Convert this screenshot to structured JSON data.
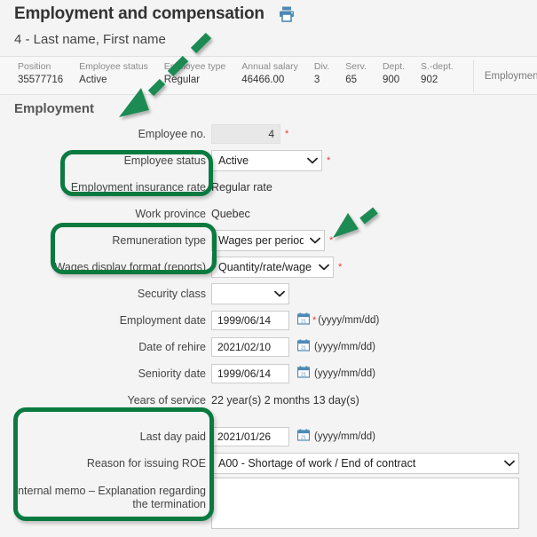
{
  "header": {
    "title": "Employment and compensation",
    "print_icon": "print-icon",
    "subtitle": "4 - Last name, First name"
  },
  "summary": {
    "cells": [
      {
        "label": "Position",
        "value": "35577716"
      },
      {
        "label": "Employee status",
        "value": "Active"
      },
      {
        "label": "Employee type",
        "value": "Regular"
      },
      {
        "label": "Annual salary",
        "value": "46466.00"
      },
      {
        "label": "Div.",
        "value": "3"
      },
      {
        "label": "Serv.",
        "value": "65"
      },
      {
        "label": "Dept.",
        "value": "900"
      },
      {
        "label": "S.-dept.",
        "value": "902"
      }
    ],
    "tab": "Employment"
  },
  "section": {
    "title": "Employment"
  },
  "fields": {
    "employee_no": {
      "label": "Employee no.",
      "value": "4",
      "required": "*"
    },
    "employee_status": {
      "label": "Employee status",
      "value": "Active",
      "required": "*"
    },
    "ei_rate": {
      "label": "Employment insurance rate",
      "value": "Regular rate"
    },
    "work_province": {
      "label": "Work province",
      "value": "Quebec"
    },
    "remuneration_type": {
      "label": "Remuneration type",
      "value": "Wages per period",
      "required": "*"
    },
    "wages_display_format": {
      "label": "Wages display format (reports)",
      "value": "Quantity/rate/wage",
      "required": "*"
    },
    "security_class": {
      "label": "Security class",
      "value": ""
    },
    "employment_date": {
      "label": "Employment date",
      "value": "1999/06/14",
      "required": "*",
      "hint": "(yyyy/mm/dd)",
      "icon": "calendar-icon"
    },
    "date_of_rehire": {
      "label": "Date of rehire",
      "value": "2021/02/10",
      "hint": "(yyyy/mm/dd)",
      "icon": "calendar-icon"
    },
    "seniority_date": {
      "label": "Seniority date",
      "value": "1999/06/14",
      "hint": "(yyyy/mm/dd)",
      "icon": "calendar-icon"
    },
    "years_of_service": {
      "label": "Years of service",
      "value": "22 year(s) 2 months 13 day(s)"
    },
    "last_day_paid": {
      "label": "Last day paid",
      "value": "2021/01/26",
      "hint": "(yyyy/mm/dd)",
      "icon": "calendar-icon"
    },
    "reason_for_roe": {
      "label": "Reason for issuing ROE",
      "value": "A00 - Shortage of work / End of contract"
    },
    "internal_memo": {
      "label_line1": "Internal memo – Explanation regarding",
      "label_line2": "the termination",
      "value": "",
      "placeholder": ""
    }
  },
  "annotations": {
    "highlight_color": "#0a7a40",
    "arrow_color": "#1f8a52",
    "highlights": [
      {
        "name": "highlight-employee-status-group"
      },
      {
        "name": "highlight-remuneration-group"
      },
      {
        "name": "highlight-termination-group"
      }
    ],
    "arrows": [
      {
        "name": "arrow-to-employment-section"
      },
      {
        "name": "arrow-to-remuneration-type"
      }
    ]
  },
  "colors": {
    "accent_blue": "#4682b4",
    "required_red": "#e8392e",
    "page_bg": "#f4f4f4"
  }
}
